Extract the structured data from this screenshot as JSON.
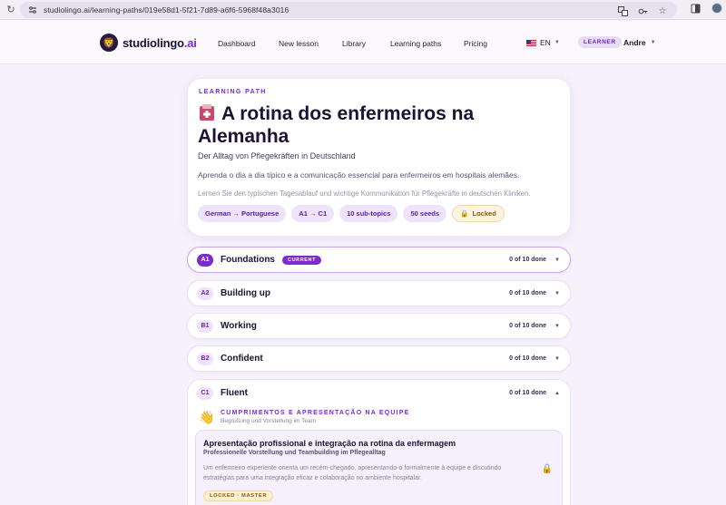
{
  "browser": {
    "url": "studiolingo.ai/learning-paths/019e58d1-5f21-7d89-a6f6-5968f48a3016"
  },
  "header": {
    "logo_text": "studiolingo",
    "logo_suffix": ".ai",
    "nav": [
      "Dashboard",
      "New lesson",
      "Library",
      "Learning paths",
      "Pricing"
    ],
    "language": "EN",
    "role": "LEARNER",
    "user": "Andre"
  },
  "path": {
    "eyebrow": "LEARNING PATH",
    "title": "A rotina dos enfermeiros na Alemanha",
    "subtitle": "Der Alltag von Pflegekräften in Deutschland",
    "description_pt": "Aprenda o dia a dia típico e a comunicação essencial para enfermeiros em hospitais alemães.",
    "description_de": "Lernen Sie den typischen Tagesablauf und wichtige Kommunikation für Pflegekräfte in deutschen Kliniken.",
    "chips": {
      "languages": "German → Portuguese",
      "levels": "A1 → C1",
      "subtopics": "10 sub-topics",
      "seeds": "50 seeds",
      "locked": "Locked"
    }
  },
  "levels": [
    {
      "code": "A1",
      "name": "Foundations",
      "tag": "CURRENT",
      "progress": "0 of 10 done"
    },
    {
      "code": "A2",
      "name": "Building up",
      "progress": "0 of 10 done"
    },
    {
      "code": "B1",
      "name": "Working",
      "progress": "0 of 10 done"
    },
    {
      "code": "B2",
      "name": "Confident",
      "progress": "0 of 10 done"
    },
    {
      "code": "C1",
      "name": "Fluent",
      "progress": "0 of 10 done"
    }
  ],
  "c1_topic": {
    "title": "CUMPRIMENTOS E APRESENTAÇÃO NA EQUIPE",
    "subtitle": "Begrüßung und Vorstellung im Team",
    "seed": {
      "title": "Apresentação profissional e integração na rotina da enfermagem",
      "subtitle": "Professionelle Vorstellung und Teambuilding im Pflegealltag",
      "description": "Um enfermeiro experiente orienta um recém-chegado, apresentando-o formalmente à equipe e discutindo estratégias para uma integração eficaz e colaboração no ambiente hospitalar.",
      "badge": "LOCKED · MASTER"
    }
  }
}
